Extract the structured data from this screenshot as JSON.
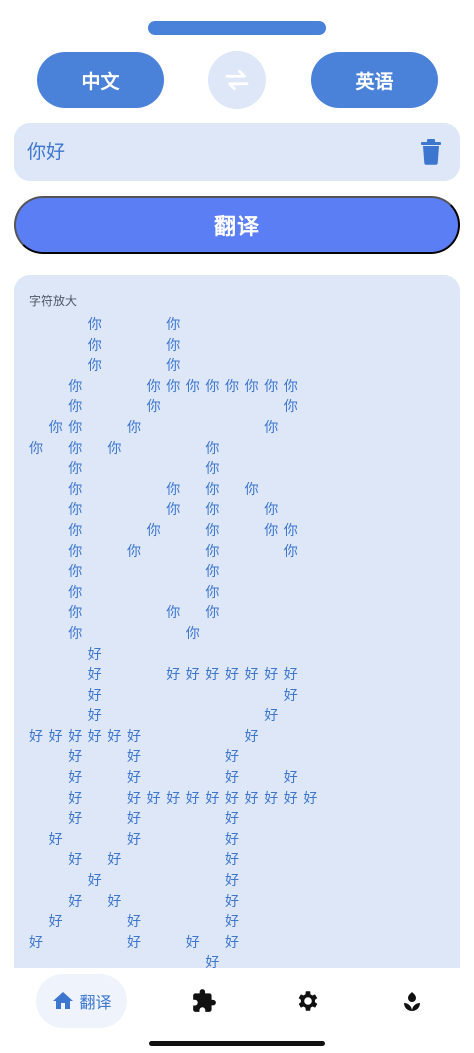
{
  "language_bar": {
    "source_label": "中文",
    "target_label": "英语",
    "swap_icon": "swap-arrows-icon"
  },
  "input": {
    "value": "你好",
    "clear_icon": "trash-icon"
  },
  "translate_button": {
    "label": "翻译"
  },
  "result": {
    "title": "字符放大",
    "art_char_1": "你",
    "art_char_2": "好"
  },
  "bottom_nav": {
    "translate_label": "翻译",
    "items": [
      "home-icon",
      "puzzle-icon",
      "gear-icon",
      "flower-icon"
    ]
  },
  "colors": {
    "accent": "#4a82da",
    "button": "#5b7ef5",
    "card": "#dde7f7"
  }
}
